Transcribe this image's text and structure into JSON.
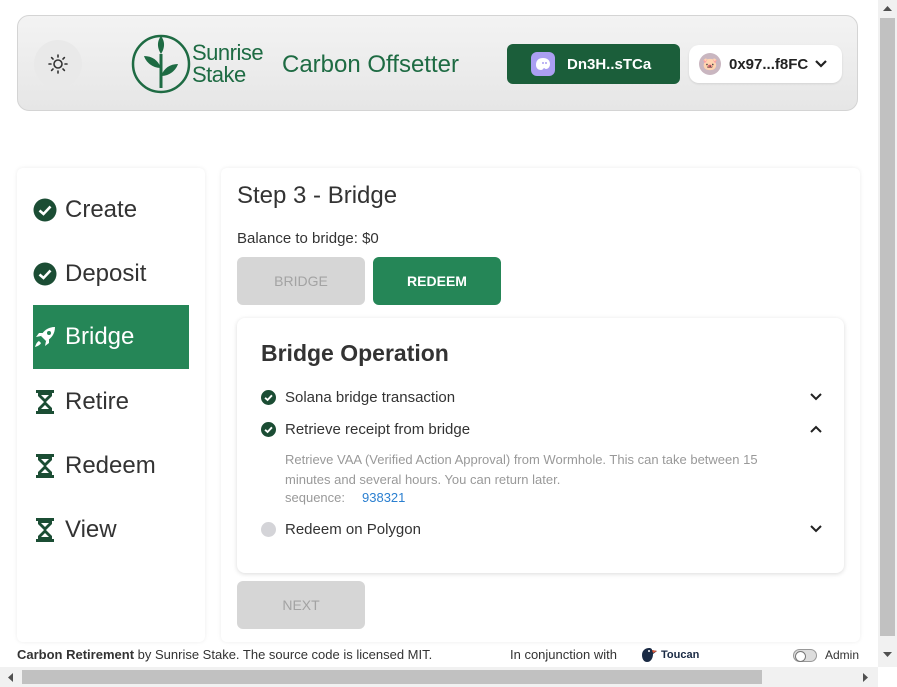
{
  "header": {
    "logo_line1": "Sunrise",
    "logo_line2": "Stake",
    "app_title": "Carbon Offsetter",
    "solana_wallet": "Dn3H..sTCa",
    "evm_wallet": "0x97...f8FC"
  },
  "sidebar": {
    "items": [
      {
        "label": "Create",
        "status": "done"
      },
      {
        "label": "Deposit",
        "status": "done"
      },
      {
        "label": "Bridge",
        "status": "active"
      },
      {
        "label": "Retire",
        "status": "pending"
      },
      {
        "label": "Redeem",
        "status": "pending"
      },
      {
        "label": "View",
        "status": "pending"
      }
    ]
  },
  "main": {
    "step_title": "Step 3 - Bridge",
    "balance": "Balance to bridge: $0",
    "bridge_button": "Bridge",
    "redeem_button": "Redeem",
    "next_button": "Next",
    "operation": {
      "title": "Bridge Operation",
      "steps": [
        {
          "label": "Solana bridge transaction",
          "status": "done",
          "expanded": false
        },
        {
          "label": "Retrieve receipt from bridge",
          "status": "done",
          "expanded": true
        },
        {
          "label": "Redeem on Polygon",
          "status": "pending",
          "expanded": false
        }
      ],
      "detail_text": "Retrieve VAA (Verified Action Approval) from Wormhole. This can take between 15 minutes and several hours. You can return later.",
      "sequence_label": "sequence:",
      "sequence_value": "938321"
    }
  },
  "footer": {
    "project_bold": "Carbon Retirement",
    "project_rest": " by Sunrise Stake. The source code is licensed MIT.",
    "conjunction": "In conjunction with",
    "partner": "Toucan",
    "admin_label": "Admin"
  },
  "colors": {
    "brand_green": "#258657",
    "dark_green": "#1b5e3a",
    "link_blue": "#2a7fd0"
  }
}
